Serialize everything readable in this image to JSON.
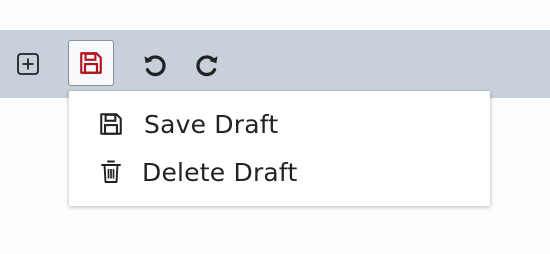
{
  "toolbar": {
    "add_icon": "plus-square-icon",
    "save_icon": "floppy-disk-icon",
    "undo_icon": "undo-icon",
    "redo_icon": "redo-icon",
    "colors": {
      "background": "#c8d0dc",
      "save_accent": "#b3121f",
      "icon": "#222222"
    }
  },
  "menu": {
    "items": [
      {
        "label": "Save Draft",
        "icon": "floppy-disk-icon"
      },
      {
        "label": "Delete Draft",
        "icon": "trash-icon"
      }
    ]
  }
}
